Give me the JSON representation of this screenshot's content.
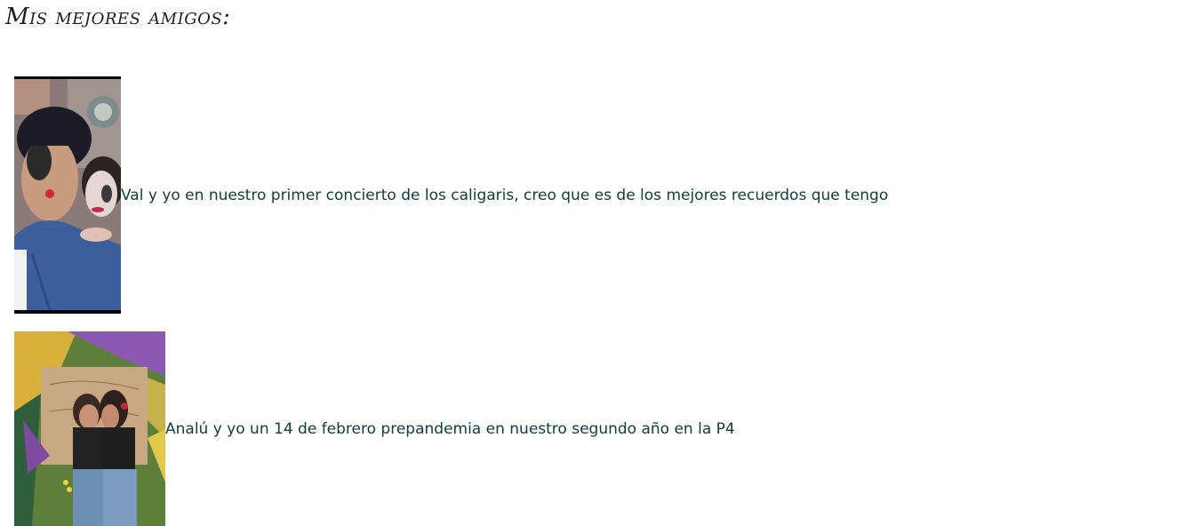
{
  "page": {
    "title": "Mis mejores amigos:"
  },
  "friends": [
    {
      "photo_icon": "concert-selfie-photo",
      "caption": "Val y yo en nuestro primer concierto de los caligaris, creo que es de los mejores recuerdos que tengo"
    },
    {
      "photo_icon": "mural-friends-photo",
      "caption": "Analú y yo un 14 de febrero prepandemia en nuestro segundo año en la P4"
    }
  ],
  "colors": {
    "caption_text": "#0f3d3a",
    "title_text": "#222222"
  }
}
